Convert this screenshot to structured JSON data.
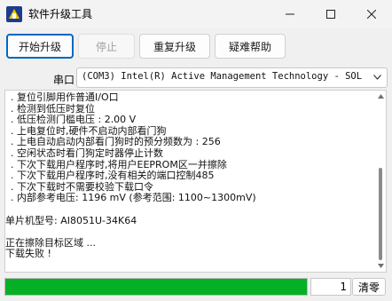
{
  "window": {
    "title": "软件升级工具",
    "icon": "app-icon",
    "controls": [
      "minimize-icon",
      "maximize-icon",
      "close-icon"
    ]
  },
  "toolbar": {
    "start_label": "开始升级",
    "stop_label": "停止",
    "retry_label": "重复升级",
    "help_label": "疑难帮助"
  },
  "port": {
    "label": "串口",
    "value": "(COM3) Intel(R) Active Management Technology - SOL"
  },
  "log": {
    "lines": [
      ". 复位引脚用作普通I/O口",
      ". 检测到低压时复位",
      ". 低压检测门槛电压 : 2.00 V",
      ". 上电复位时,硬件不启动内部看门狗",
      ". 上电自动启动内部看门狗时的预分频数为 : 256",
      ". 空闲状态时看门狗定时器停止计数",
      ". 下次下载用户程序时,将用户EEPROM区一并擦除",
      ". 下次下载用户程序时,没有相关的端口控制485",
      ". 下次下载时不需要校验下载口令",
      ". 内部参考电压: 1196 mV (参考范围: 1100~1300mV)",
      "",
      "  单片机型号: AI8051U-34K64",
      "",
      "正在擦除目标区域 ...",
      "下载失败 !"
    ]
  },
  "status": {
    "progress_percent": 100,
    "progress_color": "#06b025",
    "count": "1",
    "clear_label": "清零"
  }
}
